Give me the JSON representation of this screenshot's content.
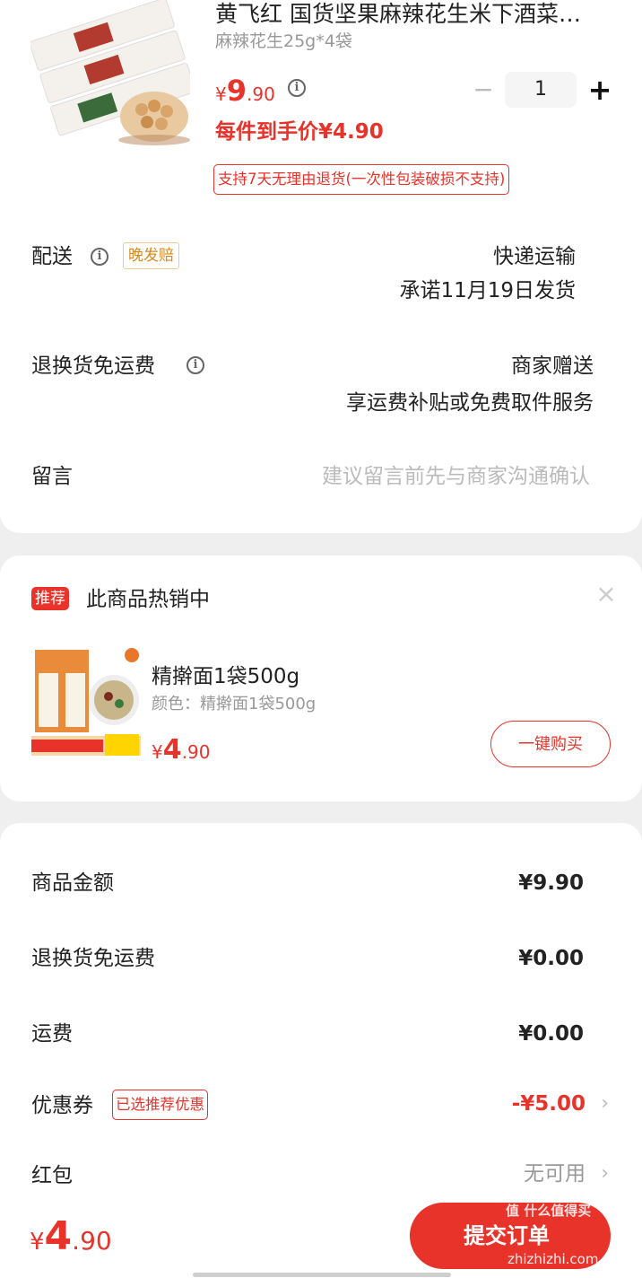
{
  "product": {
    "title": "黄飞红 国货坚果麻辣花生米下酒菜…",
    "spec": "麻辣花生25g*4袋",
    "price_symbol": "¥",
    "price_int": "9",
    "price_dec": ".90",
    "quantity": "1",
    "minus": "−",
    "plus": "+",
    "per_item_price": "每件到手价¥4.90",
    "return_policy": "支持7天无理由退货(一次性包装破损不支持)"
  },
  "delivery": {
    "label": "配送",
    "badge": "晚发赔",
    "method": "快递运输",
    "promise": "承诺11月19日发货"
  },
  "return_shipping": {
    "label": "退换货免运费",
    "value": "商家赠送",
    "detail": "享运费补贴或免费取件服务"
  },
  "message": {
    "label": "留言",
    "placeholder": "建议留言前先与商家沟通确认"
  },
  "recommend": {
    "badge": "推荐",
    "title": "此商品热销中",
    "close": "×",
    "item_name": "精擀面1袋500g",
    "item_spec": "颜色：精擀面1袋500g",
    "price_symbol": "¥",
    "price_int": "4",
    "price_dec": ".90",
    "buy_button": "一键购买"
  },
  "summary": {
    "rows": [
      {
        "label": "商品金额",
        "value": "¥9.90"
      },
      {
        "label": "退换货免运费",
        "value": "¥0.00"
      },
      {
        "label": "运费",
        "value": "¥0.00"
      }
    ],
    "coupon_label": "优惠券",
    "coupon_tag": "已选推荐优惠",
    "coupon_value": "-¥5.00",
    "redpacket_label": "红包",
    "redpacket_value": "无可用",
    "chevron": "›"
  },
  "footer": {
    "total_symbol": "¥",
    "total_int": "4",
    "total_dec": ".90",
    "submit_label": "提交订单",
    "watermark_text": "值 什么值得买",
    "watermark_url": "zhizhizhi.com"
  },
  "colors": {
    "accent": "#e8332b",
    "badge_orange": "#d98a1c",
    "background": "#efefef"
  }
}
